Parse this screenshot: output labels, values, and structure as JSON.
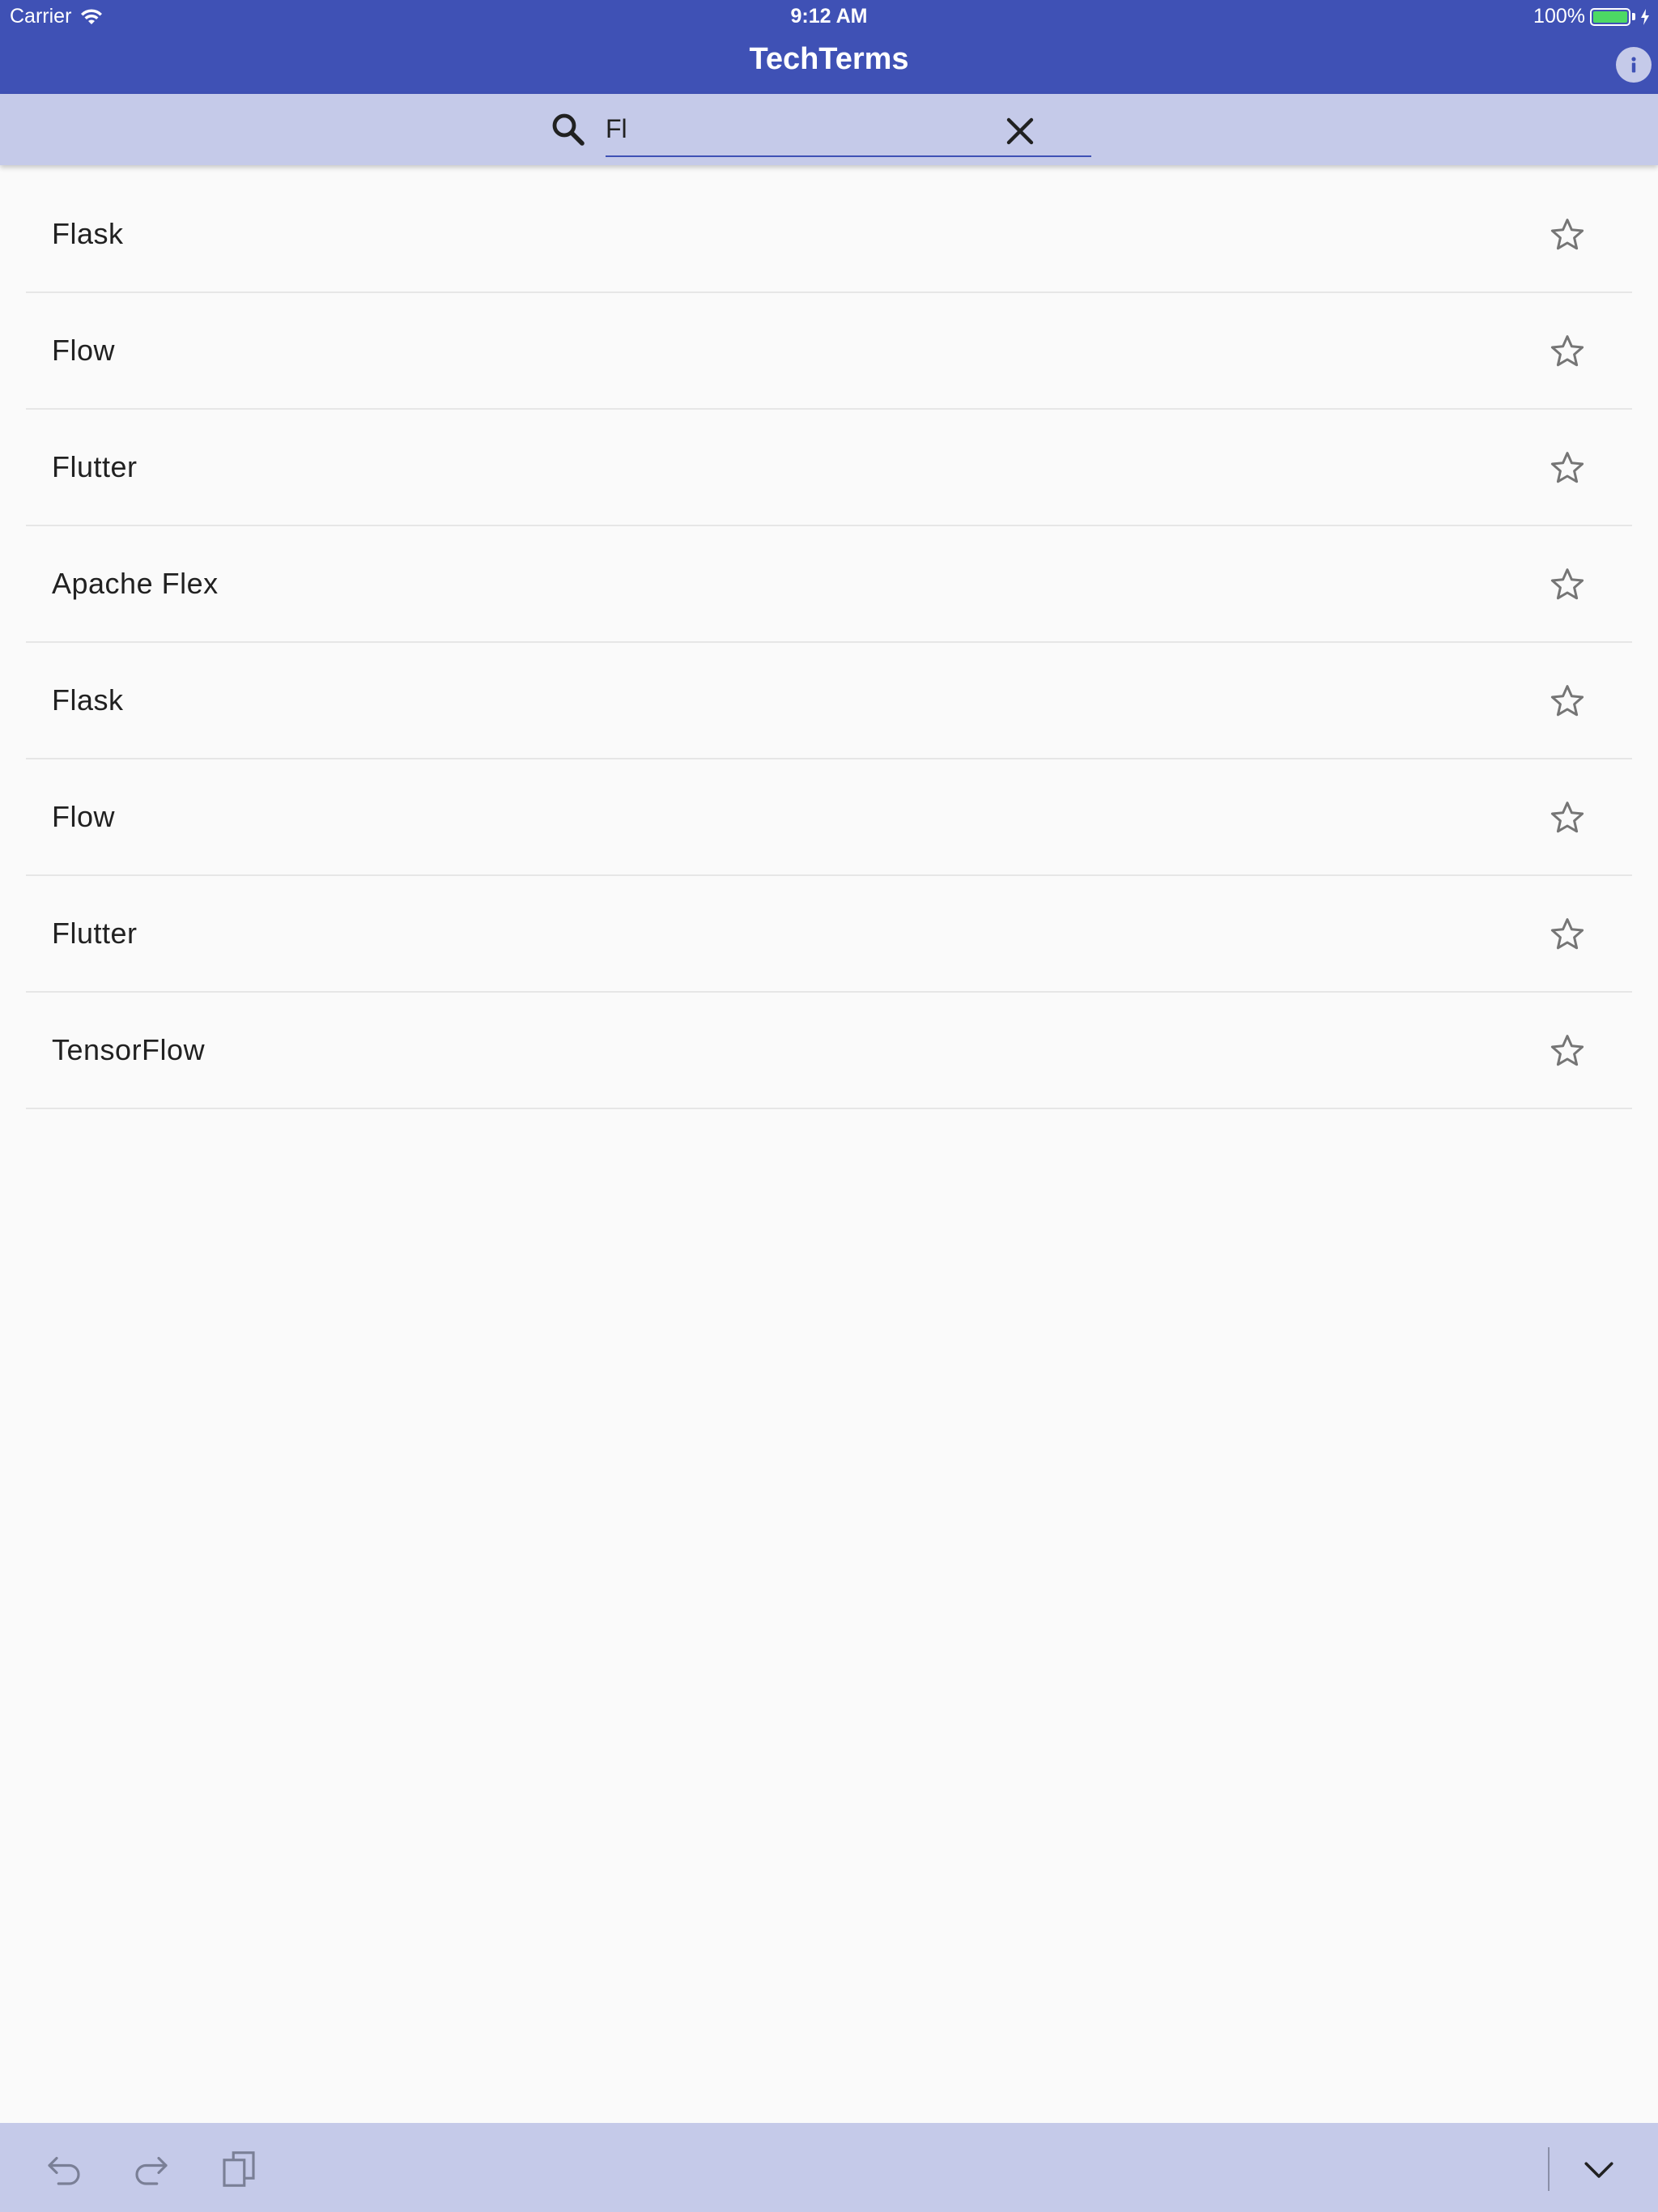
{
  "status_bar": {
    "carrier": "Carrier",
    "time": "9:12 AM",
    "battery": "100%",
    "battery_color": "#4cd964"
  },
  "app_bar": {
    "title": "TechTerms",
    "info_icon": "info-icon",
    "color": "#3f51b5"
  },
  "search": {
    "value": "Fl",
    "search_icon": "search-icon",
    "clear_icon": "close-icon",
    "background": "#c5cae9"
  },
  "terms": [
    {
      "label": "Flask",
      "favorite": false
    },
    {
      "label": "Flow",
      "favorite": false
    },
    {
      "label": "Flutter",
      "favorite": false
    },
    {
      "label": "Apache Flex",
      "favorite": false
    },
    {
      "label": "Flask",
      "favorite": false
    },
    {
      "label": "Flow",
      "favorite": false
    },
    {
      "label": "Flutter",
      "favorite": false
    },
    {
      "label": "TensorFlow",
      "favorite": false
    }
  ],
  "keyboard_toolbar": {
    "undo_icon": "undo-icon",
    "redo_icon": "redo-icon",
    "paste_icon": "paste-icon",
    "dismiss_icon": "chevron-down-icon"
  }
}
